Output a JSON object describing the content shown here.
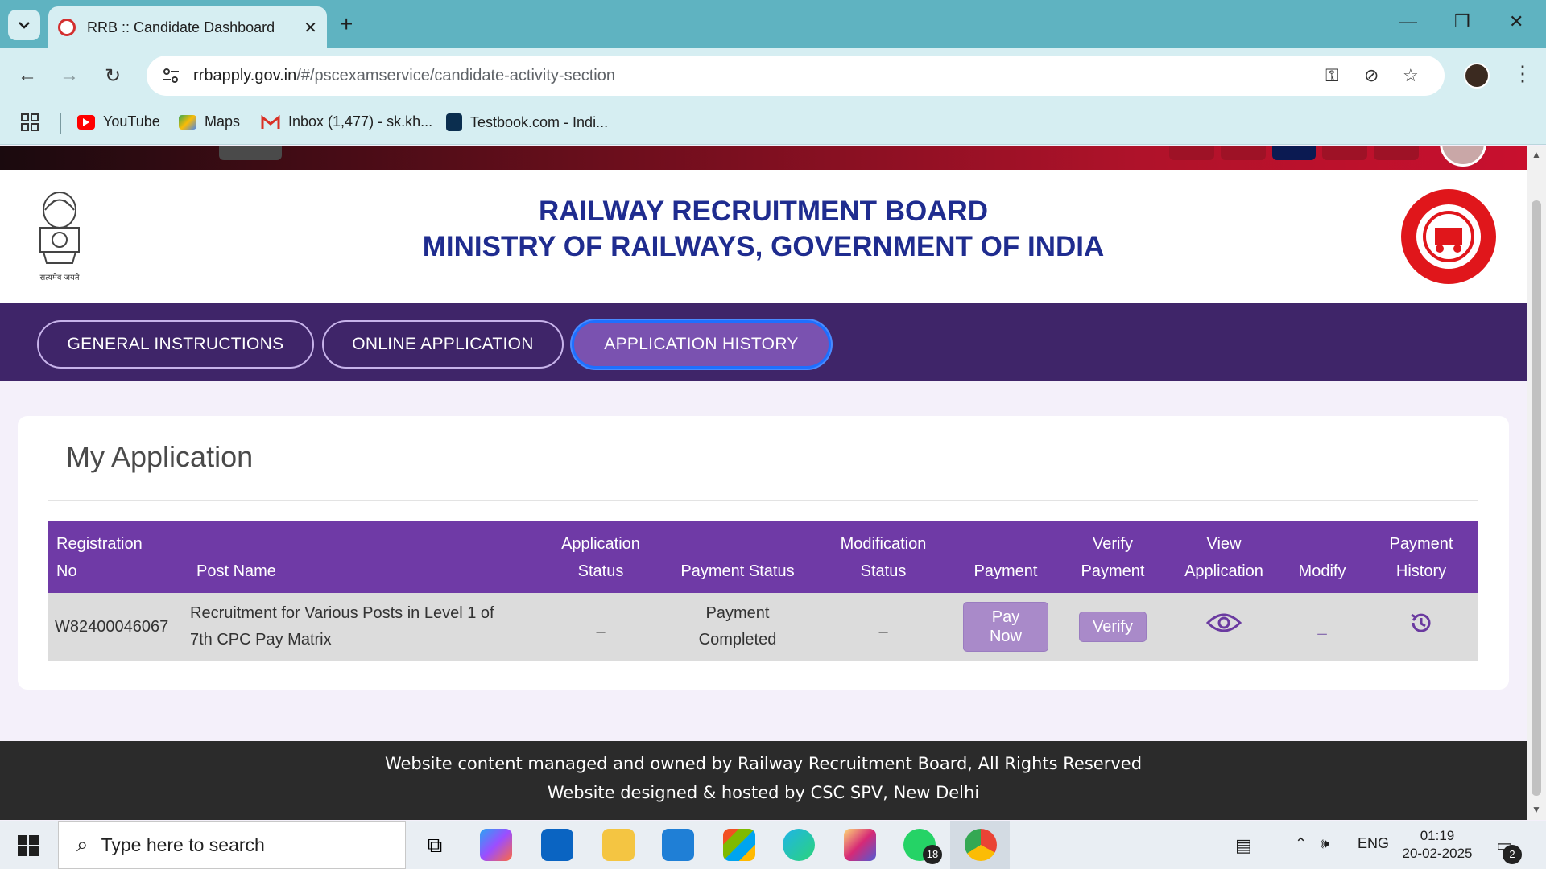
{
  "browser": {
    "tab_title": "RRB :: Candidate Dashboard",
    "url_host": "rrbapply.gov.in",
    "url_path": "/#/pscexamservice/candidate-activity-section",
    "bookmarks": [
      "YouTube",
      "Maps",
      "Inbox (1,477) - sk.kh...",
      "Testbook.com - Indi..."
    ]
  },
  "header": {
    "line1": "RAILWAY RECRUITMENT BOARD",
    "line2": "MINISTRY OF RAILWAYS, GOVERNMENT OF INDIA",
    "emblem_caption": "सत्यमेव जयते",
    "logo_text": "INDIAN RAILWAYS"
  },
  "nav": {
    "items": [
      "GENERAL INSTRUCTIONS",
      "ONLINE APPLICATION",
      "APPLICATION HISTORY"
    ],
    "active": "APPLICATION HISTORY"
  },
  "card": {
    "title": "My Application",
    "columns": [
      [
        "Registration",
        "No"
      ],
      [
        "",
        "Post Name"
      ],
      [
        "Application",
        "Status"
      ],
      [
        "",
        "Payment Status"
      ],
      [
        "Modification",
        "Status"
      ],
      [
        "",
        "Payment"
      ],
      [
        "Verify",
        "Payment"
      ],
      [
        "View",
        "Application"
      ],
      [
        "",
        "Modify"
      ],
      [
        "Payment",
        "History"
      ]
    ],
    "row": {
      "registration_no": "W82400046067",
      "post_name_l1": "Recruitment for Various Posts in Level 1 of",
      "post_name_l2": "7th CPC Pay Matrix",
      "application_status": "–",
      "payment_status_l1": "Payment",
      "payment_status_l2": "Completed",
      "modification_status": "–",
      "pay_label_l1": "Pay",
      "pay_label_l2": "Now",
      "verify_label": "Verify",
      "view_icon": "eye-icon",
      "modify_value": "_",
      "history_icon": "history-icon"
    }
  },
  "footer": {
    "line1": "Website content managed and owned by Railway Recruitment Board, All Rights Reserved",
    "line2": "Website designed & hosted by CSC SPV, New Delhi"
  },
  "taskbar": {
    "search_placeholder": "Type here to search",
    "language": "ENG",
    "time": "01:19",
    "date": "20-02-2025",
    "whatsapp_badge": "18",
    "notification_badge": "2"
  },
  "colors": {
    "nav_bg": "#3f2569",
    "table_header": "#6f3aa6",
    "title_blue": "#1f2c8f",
    "footer_bg": "#2b2b2b"
  }
}
